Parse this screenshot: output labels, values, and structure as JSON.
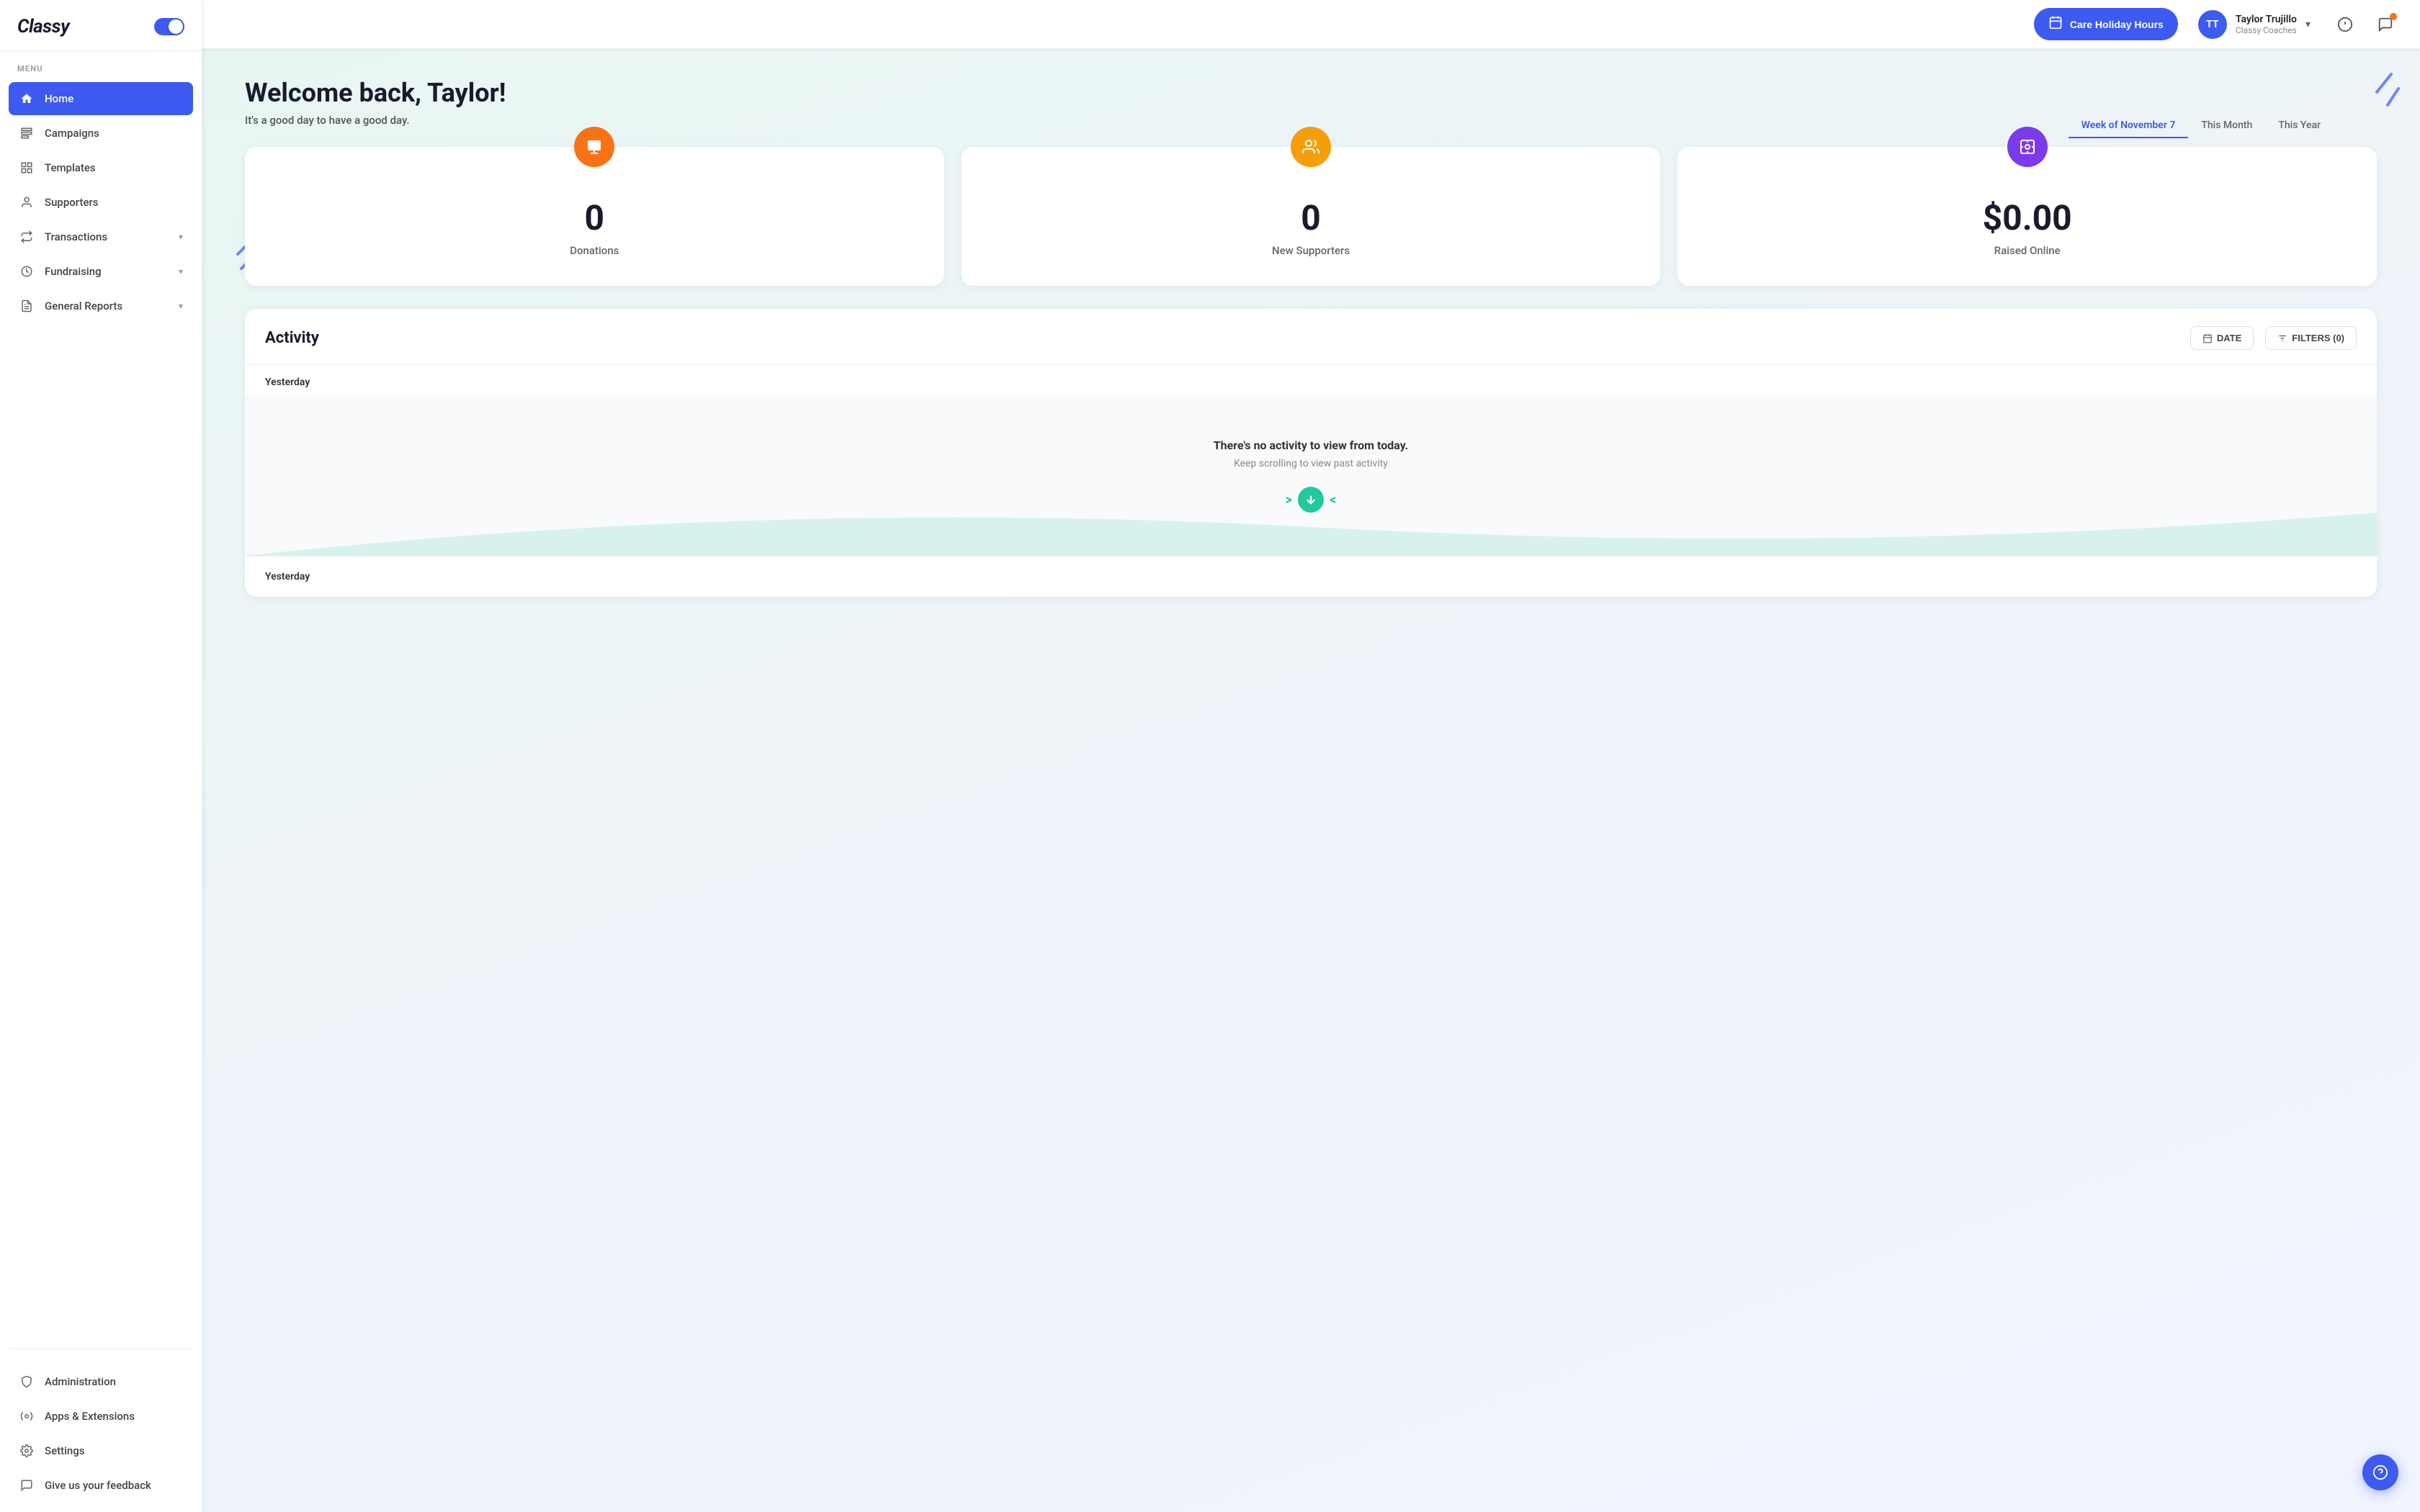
{
  "app": {
    "logo": "Classy",
    "toggle_state": true
  },
  "sidebar": {
    "menu_label": "MENU",
    "items": [
      {
        "id": "home",
        "label": "Home",
        "icon": "🏠",
        "active": true,
        "has_chevron": false
      },
      {
        "id": "campaigns",
        "label": "Campaigns",
        "icon": "📢",
        "active": false,
        "has_chevron": false
      },
      {
        "id": "templates",
        "label": "Templates",
        "icon": "🗂",
        "active": false,
        "has_chevron": false
      },
      {
        "id": "supporters",
        "label": "Supporters",
        "icon": "👤",
        "active": false,
        "has_chevron": false
      },
      {
        "id": "transactions",
        "label": "Transactions",
        "icon": "🔄",
        "active": false,
        "has_chevron": true
      },
      {
        "id": "fundraising",
        "label": "Fundraising",
        "icon": "🎯",
        "active": false,
        "has_chevron": true
      },
      {
        "id": "general-reports",
        "label": "General Reports",
        "icon": "📋",
        "active": false,
        "has_chevron": true
      }
    ],
    "bottom_items": [
      {
        "id": "administration",
        "label": "Administration",
        "icon": "🛡"
      },
      {
        "id": "apps-extensions",
        "label": "Apps & Extensions",
        "icon": "🔧"
      },
      {
        "id": "settings",
        "label": "Settings",
        "icon": "⚙"
      },
      {
        "id": "feedback",
        "label": "Give us your feedback",
        "icon": "💬"
      }
    ]
  },
  "topbar": {
    "holiday_btn_label": "Care Holiday Hours",
    "holiday_icon": "📅",
    "user": {
      "name": "Taylor Trujillo",
      "role": "Classy Coaches",
      "initials": "TT"
    },
    "info_icon": "ℹ",
    "chat_icon": "💬"
  },
  "main": {
    "welcome_title": "Welcome back, Taylor!",
    "welcome_subtitle": "It's a good day to have a good day.",
    "period_tabs": [
      {
        "label": "Week of November 7",
        "active": true
      },
      {
        "label": "This Month",
        "active": false
      },
      {
        "label": "This Year",
        "active": false
      }
    ],
    "stats": [
      {
        "id": "donations",
        "value": "0",
        "label": "Donations",
        "icon": "🖼",
        "icon_color": "orange"
      },
      {
        "id": "new-supporters",
        "value": "0",
        "label": "New Supporters",
        "icon": "👥",
        "icon_color": "amber"
      },
      {
        "id": "raised-online",
        "value": "$0.00",
        "label": "Raised Online",
        "icon": "📷",
        "icon_color": "purple"
      }
    ],
    "activity": {
      "title": "Activity",
      "date_btn_label": "DATE",
      "filters_btn_label": "FILTERS (0)",
      "yesterday_label": "Yesterday",
      "empty_title": "There's no activity to view from today.",
      "empty_subtitle": "Keep scrolling to view past activity",
      "bottom_yesterday_label": "Yesterday"
    }
  }
}
